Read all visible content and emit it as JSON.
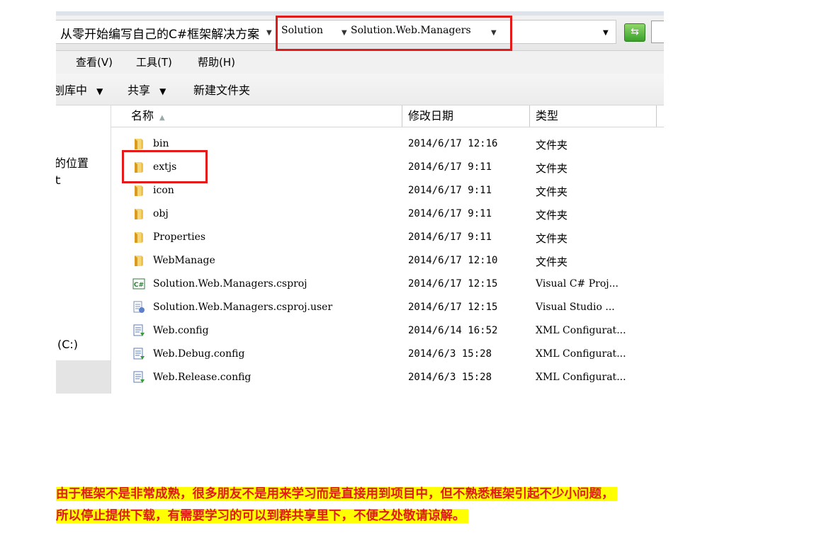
{
  "address_bar": {
    "crumbs": [
      "从零开始编写自己的C#框架解决方案",
      "Solution",
      "Solution.Web.Managers"
    ],
    "separator_icon": "chevron-down-icon",
    "refresh_icon": "refresh-icon"
  },
  "menu": {
    "items": [
      "查看(V)",
      "工具(T)",
      "帮助(H)"
    ]
  },
  "command_bar": {
    "items": [
      {
        "label": "刨库中",
        "has_dropdown": true
      },
      {
        "label": "共享",
        "has_dropdown": true
      },
      {
        "label": "新建文件夹",
        "has_dropdown": false
      }
    ],
    "dropdown_glyph": "▼"
  },
  "nav_pane": {
    "items": [
      "的位置",
      "ｔ",
      "(C:)"
    ]
  },
  "columns": {
    "name": "名称",
    "modified": "修改日期",
    "type": "类型",
    "sort_glyph": "▲"
  },
  "files": [
    {
      "name": "bin",
      "modified": "2014/6/17 12:16",
      "type": "文件夹",
      "icon": "folder-icon"
    },
    {
      "name": "extjs",
      "modified": "2014/6/17 9:11",
      "type": "文件夹",
      "icon": "folder-icon"
    },
    {
      "name": "icon",
      "modified": "2014/6/17 9:11",
      "type": "文件夹",
      "icon": "folder-icon"
    },
    {
      "name": "obj",
      "modified": "2014/6/17 9:11",
      "type": "文件夹",
      "icon": "folder-icon"
    },
    {
      "name": "Properties",
      "modified": "2014/6/17 9:11",
      "type": "文件夹",
      "icon": "folder-icon"
    },
    {
      "name": "WebManage",
      "modified": "2014/6/17 12:10",
      "type": "文件夹",
      "icon": "folder-icon"
    },
    {
      "name": "Solution.Web.Managers.csproj",
      "modified": "2014/6/17 12:15",
      "type": "Visual C# Proj...",
      "icon": "csharp-project-icon"
    },
    {
      "name": "Solution.Web.Managers.csproj.user",
      "modified": "2014/6/17 12:15",
      "type": "Visual Studio ...",
      "icon": "vs-user-file-icon"
    },
    {
      "name": "Web.config",
      "modified": "2014/6/14 16:52",
      "type": "XML Configurat...",
      "icon": "config-file-icon"
    },
    {
      "name": "Web.Debug.config",
      "modified": "2014/6/3 15:28",
      "type": "XML Configurat...",
      "icon": "config-file-icon"
    },
    {
      "name": "Web.Release.config",
      "modified": "2014/6/3 15:28",
      "type": "XML Configurat...",
      "icon": "config-file-icon"
    }
  ],
  "notice": {
    "line1": "由于框架不是非常成熟，很多朋友不是用来学习而是直接用到项目中，但不熟悉框架引起不少小问题，",
    "line2": "所以停止提供下载，有需要学习的可以到群共享里下，不便之处敬请谅解。"
  },
  "colors": {
    "highlight_box": "#e21a1a",
    "notice_text": "#e11a1a",
    "notice_bg": "#ffff00",
    "folder": "#e8b53c"
  }
}
